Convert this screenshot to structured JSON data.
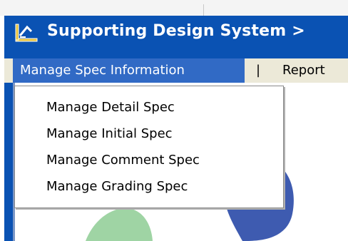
{
  "window": {
    "title": "Supporting Design System >",
    "icon": "ruler-square-icon"
  },
  "menubar": {
    "items": [
      {
        "label": "Manage Spec Information",
        "active": true
      },
      {
        "label": "Report",
        "active": false
      }
    ],
    "separator": "|"
  },
  "dropdown": {
    "items": [
      {
        "label": "Manage Detail Spec"
      },
      {
        "label": "Manage Initial Spec"
      },
      {
        "label": "Manage Comment Spec"
      },
      {
        "label": "Manage Grading Spec"
      }
    ]
  },
  "colors": {
    "title_bar": "#0a52b3",
    "menu_highlight": "#316ac5",
    "menu_bar": "#ece9d8",
    "decor_blue": "#3e5bb0",
    "decor_green": "#9fd4a4"
  }
}
